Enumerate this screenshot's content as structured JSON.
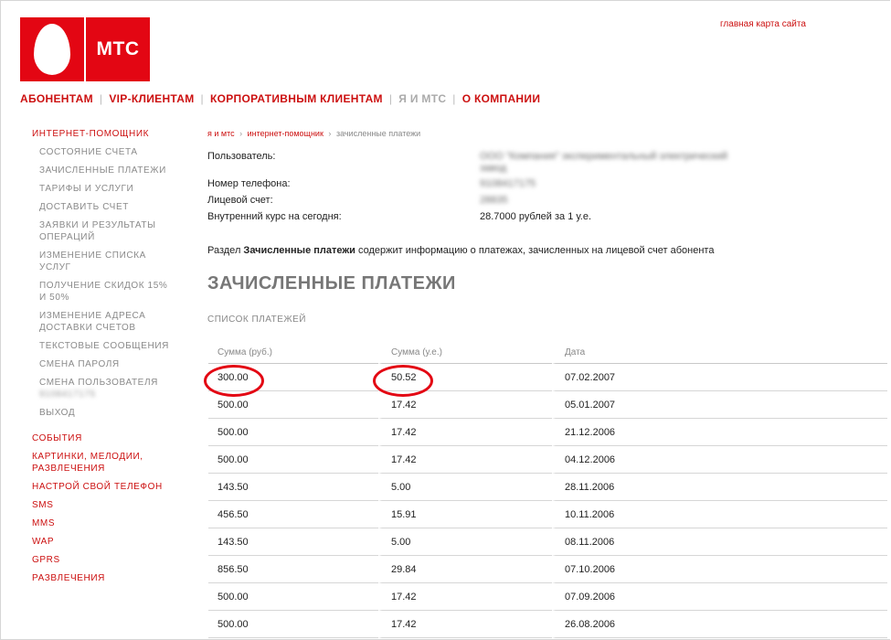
{
  "logo": {
    "text": "МТС"
  },
  "top_link": "главная карта сайта",
  "nav": {
    "items": [
      {
        "label": "АБОНЕНТАМ"
      },
      {
        "label": "VIP-КЛИЕНТАМ"
      },
      {
        "label": "КОРПОРАТИВНЫМ КЛИЕНТАМ"
      },
      {
        "label": "Я И МТС"
      },
      {
        "label": "О КОМПАНИИ"
      }
    ]
  },
  "sidebar": {
    "head": "ИНТЕРНЕТ-ПОМОЩНИК",
    "sub": [
      "СОСТОЯНИЕ СЧЕТА",
      "ЗАЧИСЛЕННЫЕ ПЛАТЕЖИ",
      "ТАРИФЫ И УСЛУГИ",
      "ДОСТАВИТЬ СЧЕТ",
      "ЗАЯВКИ И РЕЗУЛЬТАТЫ ОПЕРАЦИЙ",
      "ИЗМЕНЕНИЕ СПИСКА УСЛУГ",
      "ПОЛУЧЕНИЕ СКИДОК 15% И 50%",
      "ИЗМЕНЕНИЕ АДРЕСА ДОСТАВКИ СЧЕТОВ",
      "ТЕКСТОВЫЕ СООБЩЕНИЯ",
      "СМЕНА ПАРОЛЯ",
      "СМЕНА ПОЛЬЗОВАТЕЛЯ",
      "ВЫХОД"
    ],
    "blurred_phone": "9108417175",
    "sections": [
      "СОБЫТИЯ",
      "КАРТИНКИ, МЕЛОДИИ, РАЗВЛЕЧЕНИЯ",
      "НАСТРОЙ СВОЙ ТЕЛЕФОН",
      "SMS",
      "MMS",
      "WAP",
      "GPRS",
      "РАЗВЛЕЧЕНИЯ"
    ]
  },
  "breadcrumb": {
    "link1": "я и мтс",
    "link2": "интернет-помощник",
    "current": "зачисленные платежи",
    "sep": "›"
  },
  "info": {
    "user_label": "Пользователь:",
    "user_value": "ООО \"Компания\" экспериментальный электрический завод",
    "phone_label": "Номер телефона:",
    "phone_value": "9108417175",
    "account_label": "Лицевой счет:",
    "account_value": "28835",
    "rate_label": "Внутренний курс на сегодня:",
    "rate_value": "28.7000 рублей за 1 у.е."
  },
  "description": {
    "prefix": "Раздел ",
    "bold": "Зачисленные платежи",
    "suffix": " содержит информацию о платежах, зачисленных на лицевой счет абонента"
  },
  "page_title": "ЗАЧИСЛЕННЫЕ ПЛАТЕЖИ",
  "subtitle": "СПИСОК ПЛАТЕЖЕЙ",
  "table": {
    "headers": [
      "Сумма (руб.)",
      "Сумма (у.е.)",
      "Дата"
    ],
    "rows": [
      [
        "300.00",
        "50.52",
        "07.02.2007"
      ],
      [
        "500.00",
        "17.42",
        "05.01.2007"
      ],
      [
        "500.00",
        "17.42",
        "21.12.2006"
      ],
      [
        "500.00",
        "17.42",
        "04.12.2006"
      ],
      [
        "143.50",
        "5.00",
        "28.11.2006"
      ],
      [
        "456.50",
        "15.91",
        "10.11.2006"
      ],
      [
        "143.50",
        "5.00",
        "08.11.2006"
      ],
      [
        "856.50",
        "29.84",
        "07.10.2006"
      ],
      [
        "500.00",
        "17.42",
        "07.09.2006"
      ],
      [
        "500.00",
        "17.42",
        "26.08.2006"
      ]
    ]
  },
  "colors": {
    "brand_red": "#e30613",
    "link_red": "#cc1010"
  }
}
